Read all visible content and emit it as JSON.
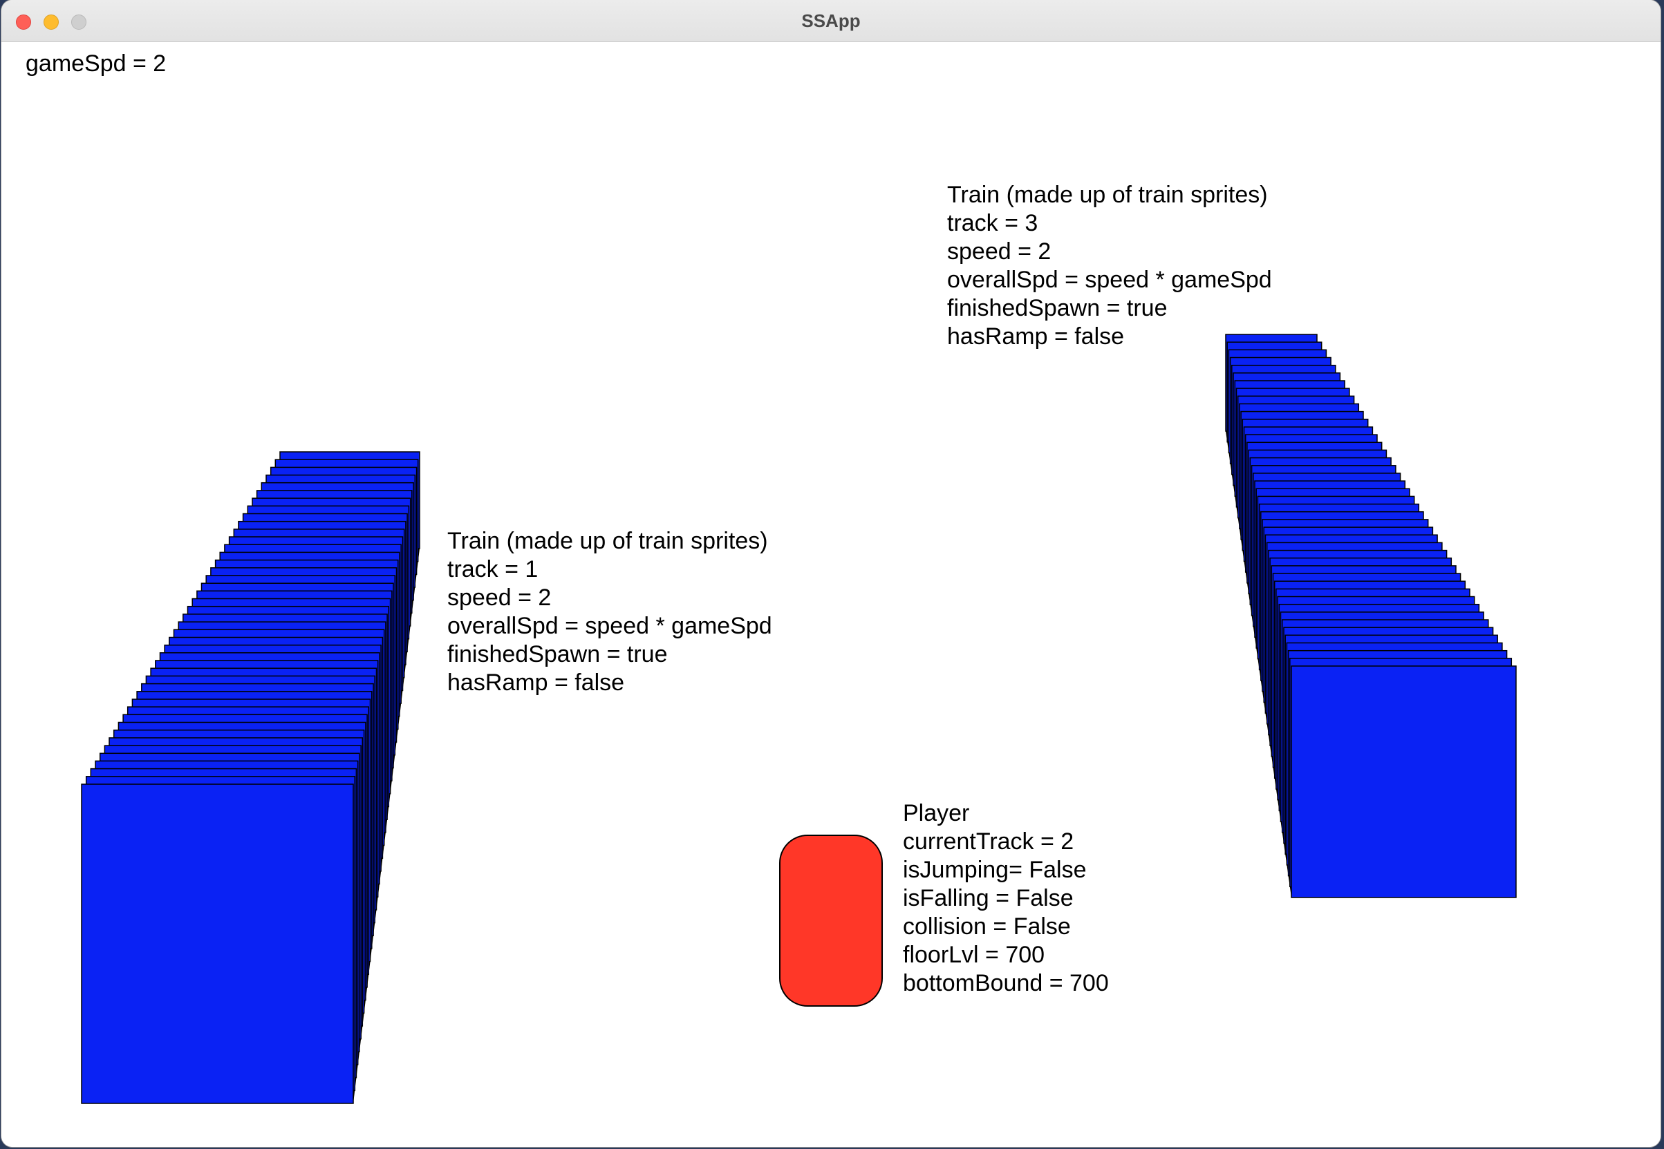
{
  "window": {
    "title": "SSApp"
  },
  "game": {
    "game_speed_text": "gameSpd = 2"
  },
  "train_left": {
    "lines": [
      "Train (made up of train sprites)",
      "track = 1",
      "speed = 2",
      "overallSpd = speed * gameSpd",
      "finishedSpawn = true",
      "hasRamp = false"
    ]
  },
  "train_right": {
    "lines": [
      "Train (made up of train sprites)",
      "track = 3",
      "speed = 2",
      "overallSpd = speed * gameSpd",
      "finishedSpawn = true",
      "hasRamp = false"
    ]
  },
  "player": {
    "lines": [
      "Player",
      "currentTrack = 2",
      "isJumping= False",
      "isFalling = False",
      "collision = False",
      "floorLvl = 700",
      "bottomBound = 700"
    ]
  },
  "colors": {
    "train_fill": "#0a22f4",
    "train_side": "#000000",
    "player_fill": "#ff3728",
    "window_bg": "#ffffff"
  }
}
